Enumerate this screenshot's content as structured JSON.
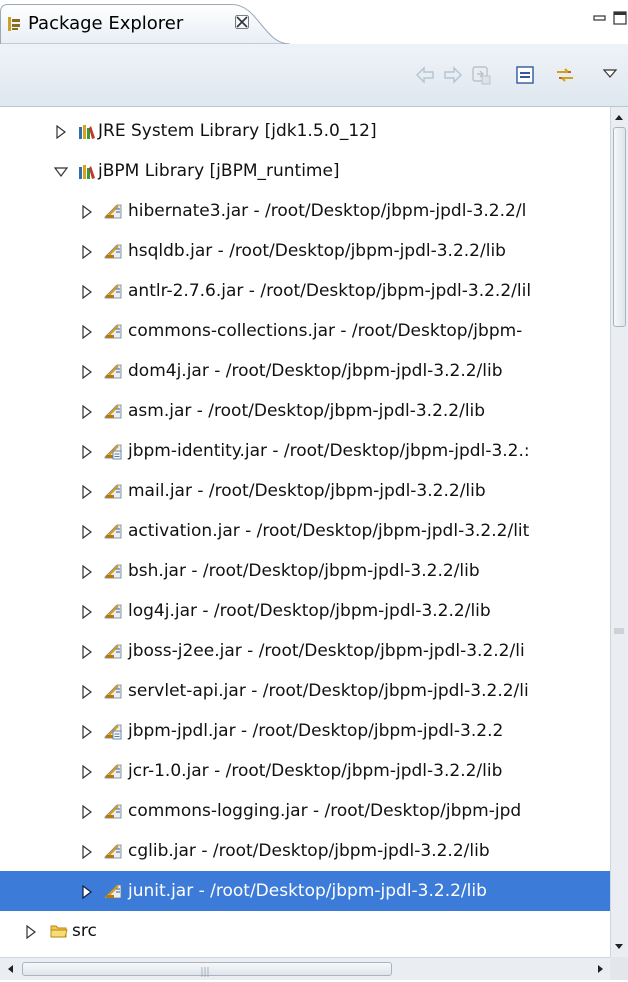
{
  "view": {
    "title": "Package Explorer",
    "icons": {
      "view": "package-explorer-icon",
      "close": "close-icon",
      "minimize": "minimize-icon",
      "maximize": "maximize-icon"
    }
  },
  "toolbar": {
    "buttons": [
      {
        "name": "back-button",
        "icon": "arrow-left-icon",
        "enabled": false
      },
      {
        "name": "forward-button",
        "icon": "arrow-right-icon",
        "enabled": false
      },
      {
        "name": "go-into-button",
        "icon": "go-into-icon",
        "enabled": false
      },
      {
        "name": "collapse-all-button",
        "icon": "collapse-all-icon",
        "enabled": true
      },
      {
        "name": "link-with-editor-button",
        "icon": "link-with-editor-icon",
        "enabled": true
      },
      {
        "name": "view-menu-button",
        "icon": "triangle-down-icon",
        "enabled": true
      }
    ]
  },
  "tree": {
    "items": [
      {
        "label": "JRE System Library [jdk1.5.0_12]",
        "depth": 1,
        "expanded": false,
        "icon": "library-icon",
        "selected": false
      },
      {
        "label": "jBPM Library [jBPM_runtime]",
        "depth": 1,
        "expanded": true,
        "icon": "library-icon",
        "selected": false
      },
      {
        "label": "hibernate3.jar - /root/Desktop/jbpm-jpdl-3.2.2/l",
        "depth": 2,
        "expanded": false,
        "icon": "jar-icon",
        "selected": false
      },
      {
        "label": "hsqldb.jar - /root/Desktop/jbpm-jpdl-3.2.2/lib",
        "depth": 2,
        "expanded": false,
        "icon": "jar-icon",
        "selected": false
      },
      {
        "label": "antlr-2.7.6.jar - /root/Desktop/jbpm-jpdl-3.2.2/lil",
        "depth": 2,
        "expanded": false,
        "icon": "jar-icon",
        "selected": false
      },
      {
        "label": "commons-collections.jar - /root/Desktop/jbpm-",
        "depth": 2,
        "expanded": false,
        "icon": "jar-icon",
        "selected": false
      },
      {
        "label": "dom4j.jar - /root/Desktop/jbpm-jpdl-3.2.2/lib",
        "depth": 2,
        "expanded": false,
        "icon": "jar-icon",
        "selected": false
      },
      {
        "label": "asm.jar - /root/Desktop/jbpm-jpdl-3.2.2/lib",
        "depth": 2,
        "expanded": false,
        "icon": "jar-icon",
        "selected": false
      },
      {
        "label": "jbpm-identity.jar - /root/Desktop/jbpm-jpdl-3.2.:",
        "depth": 2,
        "expanded": false,
        "icon": "jar-source-icon",
        "selected": false
      },
      {
        "label": "mail.jar - /root/Desktop/jbpm-jpdl-3.2.2/lib",
        "depth": 2,
        "expanded": false,
        "icon": "jar-icon",
        "selected": false
      },
      {
        "label": "activation.jar - /root/Desktop/jbpm-jpdl-3.2.2/lit",
        "depth": 2,
        "expanded": false,
        "icon": "jar-icon",
        "selected": false
      },
      {
        "label": "bsh.jar - /root/Desktop/jbpm-jpdl-3.2.2/lib",
        "depth": 2,
        "expanded": false,
        "icon": "jar-icon",
        "selected": false
      },
      {
        "label": "log4j.jar - /root/Desktop/jbpm-jpdl-3.2.2/lib",
        "depth": 2,
        "expanded": false,
        "icon": "jar-icon",
        "selected": false
      },
      {
        "label": "jboss-j2ee.jar - /root/Desktop/jbpm-jpdl-3.2.2/li",
        "depth": 2,
        "expanded": false,
        "icon": "jar-icon",
        "selected": false
      },
      {
        "label": "servlet-api.jar - /root/Desktop/jbpm-jpdl-3.2.2/li",
        "depth": 2,
        "expanded": false,
        "icon": "jar-icon",
        "selected": false
      },
      {
        "label": "jbpm-jpdl.jar - /root/Desktop/jbpm-jpdl-3.2.2",
        "depth": 2,
        "expanded": false,
        "icon": "jar-source-icon",
        "selected": false
      },
      {
        "label": "jcr-1.0.jar - /root/Desktop/jbpm-jpdl-3.2.2/lib",
        "depth": 2,
        "expanded": false,
        "icon": "jar-icon",
        "selected": false
      },
      {
        "label": "commons-logging.jar - /root/Desktop/jbpm-jpd",
        "depth": 2,
        "expanded": false,
        "icon": "jar-icon",
        "selected": false
      },
      {
        "label": "cglib.jar - /root/Desktop/jbpm-jpdl-3.2.2/lib",
        "depth": 2,
        "expanded": false,
        "icon": "jar-icon",
        "selected": false
      },
      {
        "label": "junit.jar - /root/Desktop/jbpm-jpdl-3.2.2/lib",
        "depth": 2,
        "expanded": false,
        "icon": "jar-icon",
        "selected": true
      },
      {
        "label": "src",
        "depth": 0,
        "expanded": false,
        "icon": "folder-icon",
        "selected": false
      }
    ]
  },
  "colors": {
    "selection": "#3d7bd9",
    "tab_border": "#9aa9b8",
    "toolbar_bg": "#e6edf4"
  }
}
